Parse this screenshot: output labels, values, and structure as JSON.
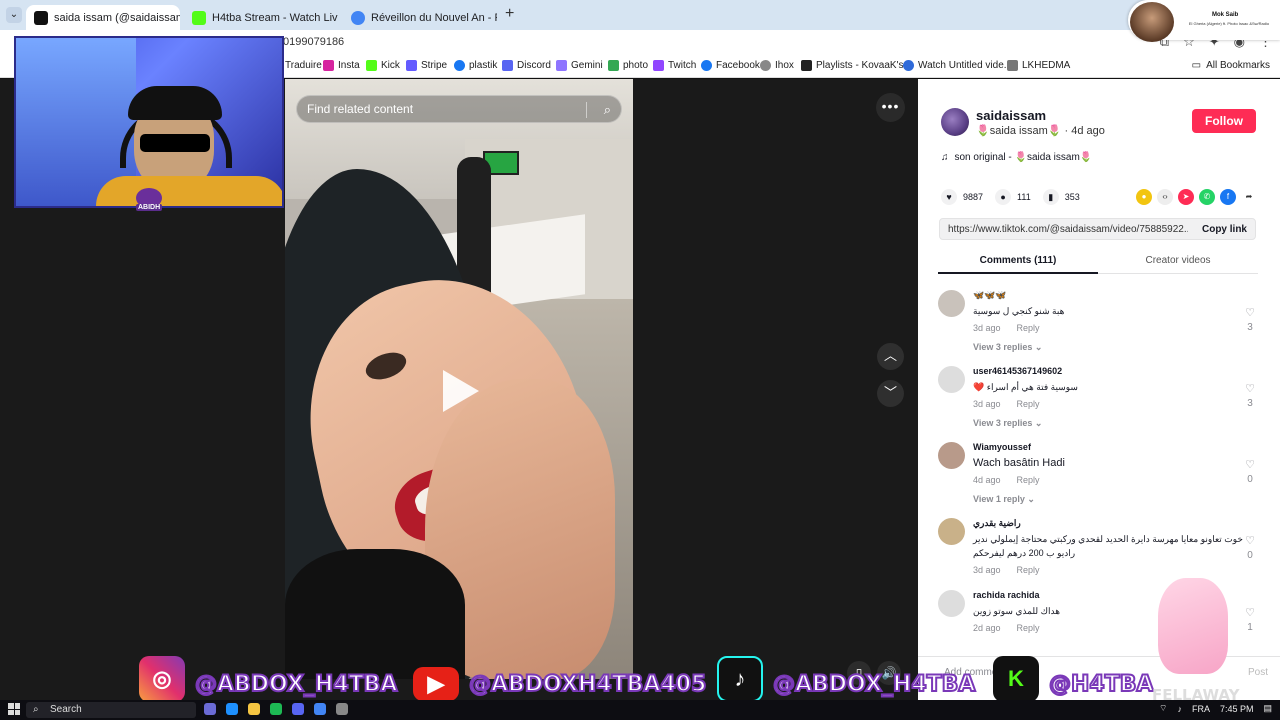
{
  "browser": {
    "tabs": [
      {
        "label": "saida issam (@saidaissam)",
        "favicon_color": "#111111",
        "active": true
      },
      {
        "label": "H4tba Stream - Watch Live on Kick",
        "favicon_color": "#53fc18",
        "active": false
      },
      {
        "label": "Réveillon du Nouvel An - Recherche",
        "favicon_color": "#4285f4",
        "active": false
      }
    ],
    "new_tab_symbol": "+",
    "url_visible": "0199079186",
    "bookmarks": [
      {
        "label": "Traduire",
        "color": "#4285f4"
      },
      {
        "label": "Insta",
        "color": "#d6249f"
      },
      {
        "label": "Kick",
        "color": "#53fc18"
      },
      {
        "label": "Stripe",
        "color": "#635bff"
      },
      {
        "label": "plastik",
        "color": "#1877f2"
      },
      {
        "label": "Discord",
        "color": "#5865f2"
      },
      {
        "label": "Gemini",
        "color": "#8e75ff"
      },
      {
        "label": "photo",
        "color": "#34a853"
      },
      {
        "label": "Twitch",
        "color": "#9146ff"
      },
      {
        "label": "Facebook",
        "color": "#1877f2"
      },
      {
        "label": "Ihox",
        "color": "#888888"
      },
      {
        "label": "Playlists - KovaaK's...",
        "color": "#222222"
      },
      {
        "label": "Watch Untitled vide...",
        "color": "#2f6ad9"
      },
      {
        "label": "LKHEDMA",
        "color": "#777777"
      }
    ],
    "all_bookmarks": "All Bookmarks"
  },
  "stream_overlay": {
    "card_name": "Mok Saib",
    "card_sub": "El Gheria (Algerie) ft. Photo Issac &Sw/Radio",
    "webcam_badge": "ABIDH"
  },
  "player": {
    "search_placeholder": "Find related content",
    "more_symbol": "•••",
    "up_symbol": "︿",
    "down_symbol": "﹀"
  },
  "post": {
    "username": "saidaissam",
    "nickname": "🌷saida issam🌷 · 4d ago",
    "follow_label": "Follow",
    "music": "son original - 🌷saida issam🌷",
    "likes": "9887",
    "comments": "111",
    "saves": "353",
    "link": "https://www.tiktok.com/@saidaissam/video/75885922...",
    "copy_label": "Copy link",
    "accent": "#fe2c55"
  },
  "panel_tabs": {
    "comments": "Comments (111)",
    "creator": "Creator videos"
  },
  "comments": [
    {
      "name": "🦋🦋🦋",
      "text": "هبة شنو كنجي ل سوسية",
      "time": "3d ago",
      "reply": "Reply",
      "replies": "View 3 replies ⌄",
      "likes": "3"
    },
    {
      "name": "user46145367149602",
      "text": "❤️ سوسية فتة هي أم اسراء",
      "time": "3d ago",
      "reply": "Reply",
      "replies": "View 3 replies ⌄",
      "likes": "3"
    },
    {
      "name": "Wiamyoussef",
      "text": "Wach basâtin Hadi",
      "time": "4d ago",
      "reply": "Reply",
      "replies": "View 1 reply ⌄",
      "likes": "0"
    },
    {
      "name": "راضية بقدري",
      "text": "خوت تعاونو معايا مهرسة دايرة الحديد لقحدي وركبتي محتاجة إيملولي ندير راديو ب 200 درهم ليفرحكم",
      "time": "3d ago",
      "reply": "Reply",
      "replies": "",
      "likes": "0"
    },
    {
      "name": "rachida rachida",
      "text": "هداك للمذي سوتو زوين",
      "time": "2d ago",
      "reply": "Reply",
      "replies": "",
      "likes": "1"
    }
  ],
  "add_comment": {
    "placeholder": "Add comment...",
    "post": "Post"
  },
  "socials": [
    {
      "handle": "@ABDOX_H4TBA",
      "badge": "◎",
      "badge_color": "#e1306c"
    },
    {
      "handle": "@ABDOXH4TBA405",
      "badge": "▶",
      "badge_color": "#e62117"
    },
    {
      "handle": "@ABDOX_H4TBA",
      "badge": "♪",
      "badge_color": "#111111"
    },
    {
      "handle": "@H4TBA",
      "badge": "K",
      "badge_color": "#1a1a1a"
    }
  ],
  "fellaway": "FELLAWAY",
  "taskbar": {
    "search": "Search",
    "lang": "FRA",
    "time": "7:45 PM"
  }
}
